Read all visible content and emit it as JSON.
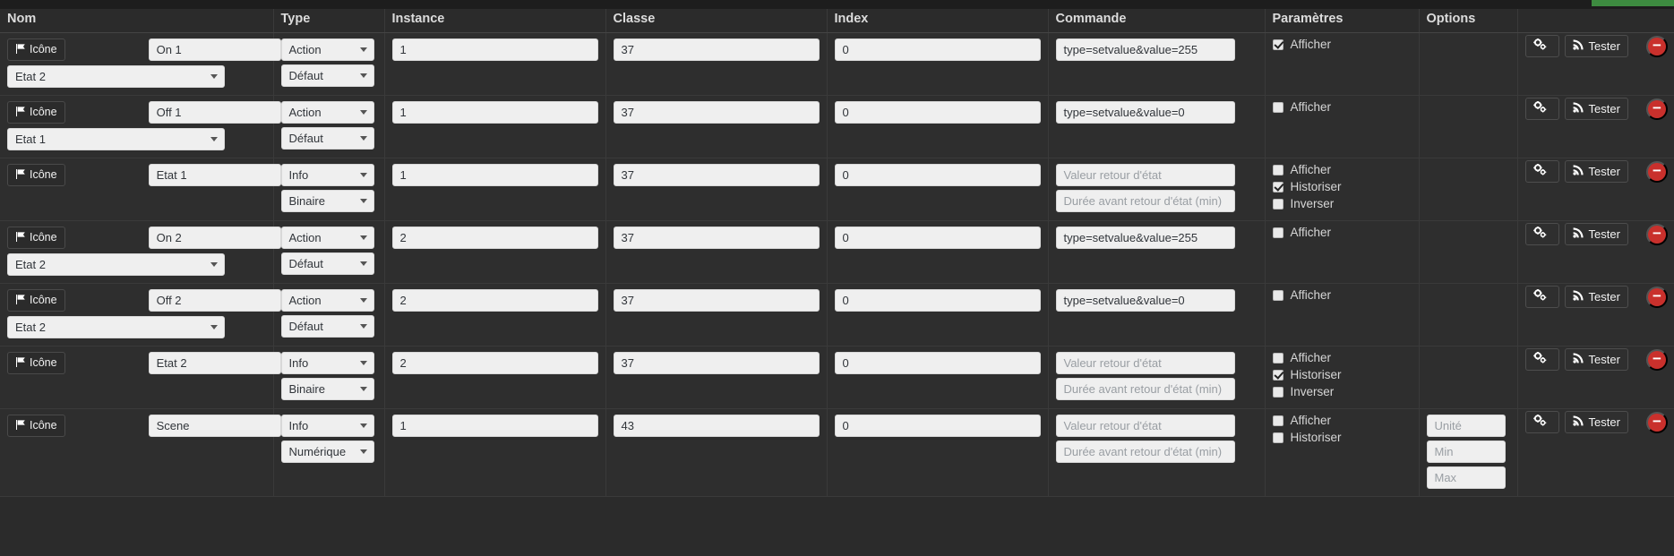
{
  "theme": {
    "background": "#2b2b2b",
    "row_background": "#2e2e2e",
    "accent_green": "#3d8b40",
    "danger_red": "#c9302c",
    "input_background": "#efefef",
    "text_color": "#d6d6d6"
  },
  "table": {
    "headers": [
      "Nom",
      "Type",
      "Instance",
      "Classe",
      "Index",
      "Commande",
      "Paramètres",
      "Options",
      ""
    ],
    "icon_button_label": "Icône",
    "test_button_label": "Tester",
    "placeholders": {
      "valeur_retour": "Valeur retour d'état",
      "duree_retour": "Durée avant retour d'état (min)",
      "unite": "Unité",
      "min": "Min",
      "max": "Max"
    },
    "rows": [
      {
        "name": "On 1",
        "name_select": "Etat 2",
        "type": "Action",
        "subtype": "Défaut",
        "instance": "1",
        "classe": "37",
        "index": "0",
        "commande": "type=setvalue&value=255",
        "commande_is_placeholder": false,
        "has_retour_fields": false,
        "params": [
          {
            "label": "Afficher",
            "checked": true
          }
        ],
        "options": []
      },
      {
        "name": "Off 1",
        "name_select": "Etat 1",
        "type": "Action",
        "subtype": "Défaut",
        "instance": "1",
        "classe": "37",
        "index": "0",
        "commande": "type=setvalue&value=0",
        "commande_is_placeholder": false,
        "has_retour_fields": false,
        "params": [
          {
            "label": "Afficher",
            "checked": false
          }
        ],
        "options": []
      },
      {
        "name": "Etat 1",
        "name_select": null,
        "type": "Info",
        "subtype": "Binaire",
        "instance": "1",
        "classe": "37",
        "index": "0",
        "commande": "Valeur retour d'état",
        "commande_is_placeholder": true,
        "has_retour_fields": true,
        "params": [
          {
            "label": "Afficher",
            "checked": false
          },
          {
            "label": "Historiser",
            "checked": true
          },
          {
            "label": "Inverser",
            "checked": false
          }
        ],
        "options": []
      },
      {
        "name": "On 2",
        "name_select": "Etat 2",
        "type": "Action",
        "subtype": "Défaut",
        "instance": "2",
        "classe": "37",
        "index": "0",
        "commande": "type=setvalue&value=255",
        "commande_is_placeholder": false,
        "has_retour_fields": false,
        "params": [
          {
            "label": "Afficher",
            "checked": false
          }
        ],
        "options": []
      },
      {
        "name": "Off 2",
        "name_select": "Etat 2",
        "type": "Action",
        "subtype": "Défaut",
        "instance": "2",
        "classe": "37",
        "index": "0",
        "commande": "type=setvalue&value=0",
        "commande_is_placeholder": false,
        "has_retour_fields": false,
        "params": [
          {
            "label": "Afficher",
            "checked": false
          }
        ],
        "options": []
      },
      {
        "name": "Etat 2",
        "name_select": null,
        "type": "Info",
        "subtype": "Binaire",
        "instance": "2",
        "classe": "37",
        "index": "0",
        "commande": "Valeur retour d'état",
        "commande_is_placeholder": true,
        "has_retour_fields": true,
        "params": [
          {
            "label": "Afficher",
            "checked": false
          },
          {
            "label": "Historiser",
            "checked": true
          },
          {
            "label": "Inverser",
            "checked": false
          }
        ],
        "options": []
      },
      {
        "name": "Scene",
        "name_select": null,
        "type": "Info",
        "subtype": "Numérique",
        "instance": "1",
        "classe": "43",
        "index": "0",
        "commande": "Valeur retour d'état",
        "commande_is_placeholder": true,
        "has_retour_fields": true,
        "params": [
          {
            "label": "Afficher",
            "checked": false
          },
          {
            "label": "Historiser",
            "checked": false
          }
        ],
        "options": [
          "Unité",
          "Min",
          "Max"
        ]
      }
    ]
  }
}
